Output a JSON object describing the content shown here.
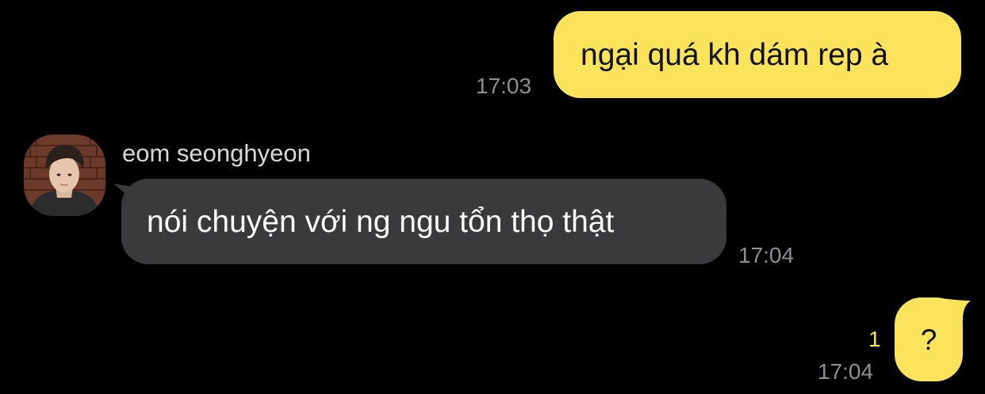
{
  "conversation": {
    "messages": [
      {
        "direction": "outgoing",
        "text": "ngại quá kh dám rep à",
        "time": "17:03"
      },
      {
        "direction": "incoming",
        "sender": "eom seonghyeon",
        "text": "nói chuyện với ng ngu tổn thọ thật",
        "time": "17:04"
      },
      {
        "direction": "outgoing",
        "text": "?",
        "time": "17:04",
        "unread_count": "1"
      }
    ]
  },
  "colors": {
    "background": "#000000",
    "outgoing_bubble": "#fbe35b",
    "incoming_bubble": "#3a3a3c",
    "timestamp": "#8e8e93",
    "unread_indicator": "#fbe35b"
  },
  "icons": {
    "avatar": "profile-photo-avatar"
  }
}
